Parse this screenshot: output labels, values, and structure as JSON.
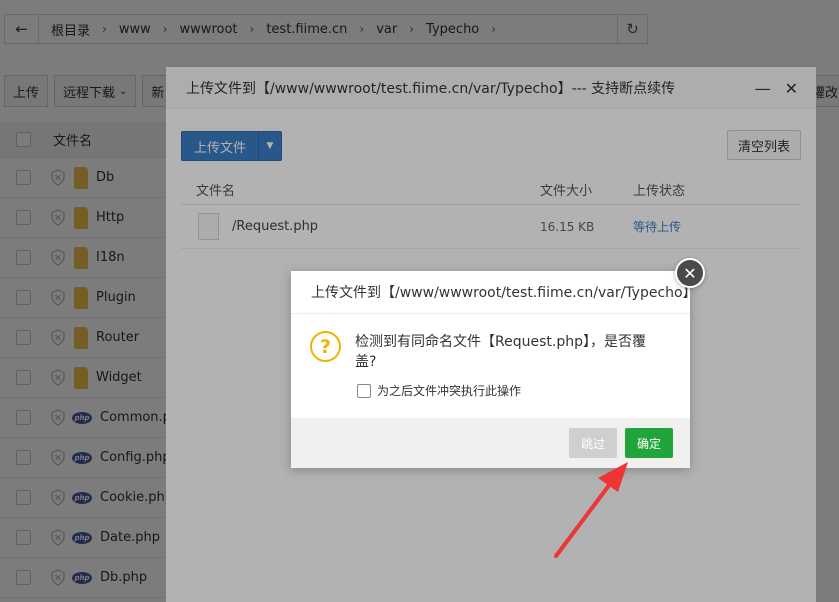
{
  "addressbar": {
    "crumbs": [
      "根目录",
      "www",
      "wwwroot",
      "test.fiime.cn",
      "var",
      "Typecho"
    ]
  },
  "toolbar": {
    "upload_label": "上传",
    "remote_download_label": "远程下载",
    "new_label": "新",
    "right_label": "權改"
  },
  "filelist": {
    "header": "文件名",
    "items": [
      {
        "name": "Db",
        "type": "folder"
      },
      {
        "name": "Http",
        "type": "folder"
      },
      {
        "name": "I18n",
        "type": "folder"
      },
      {
        "name": "Plugin",
        "type": "folder"
      },
      {
        "name": "Router",
        "type": "folder"
      },
      {
        "name": "Widget",
        "type": "folder"
      },
      {
        "name": "Common.php",
        "type": "php"
      },
      {
        "name": "Config.php",
        "type": "php"
      },
      {
        "name": "Cookie.php",
        "type": "php"
      },
      {
        "name": "Date.php",
        "type": "php"
      },
      {
        "name": "Db.php",
        "type": "php"
      }
    ]
  },
  "upload_dialog": {
    "title": "上传文件到【/www/wwwroot/test.fiime.cn/var/Typecho】--- 支持断点续传",
    "minimize_icon": "minimize-icon",
    "close_icon": "close-icon",
    "upload_button": "上传文件",
    "clear_button": "清空列表",
    "col_name": "文件名",
    "col_size": "文件大小",
    "col_status": "上传状态",
    "rows": [
      {
        "name": "/Request.php",
        "size": "16.15 KB",
        "status": "等待上传"
      }
    ]
  },
  "confirm_dialog": {
    "title": "上传文件到【/www/wwwroot/test.fiime.cn/var/Typecho】",
    "message": "检测到有同命名文件【Request.php】，是否覆盖?",
    "checkbox_label": "为之后文件冲突执行此操作",
    "skip_button": "跳过",
    "ok_button": "确定",
    "ok_color": "#20a53a"
  }
}
